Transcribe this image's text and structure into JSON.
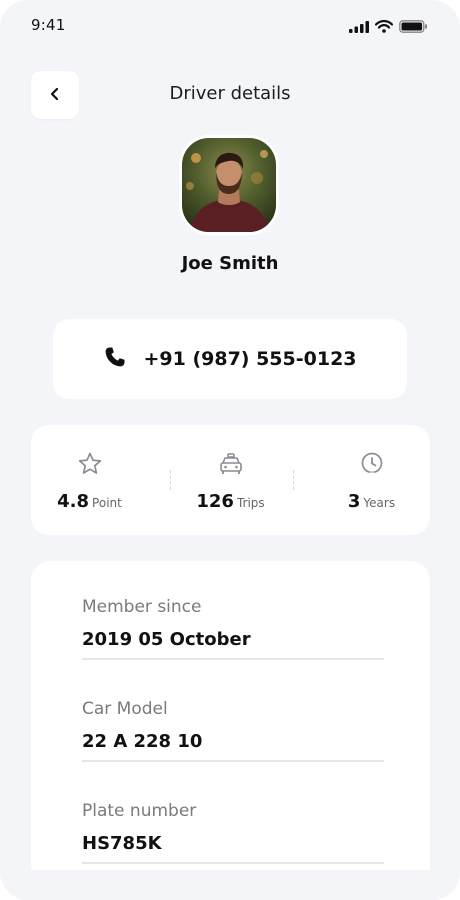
{
  "status_bar": {
    "time": "9:41"
  },
  "header": {
    "title": "Driver details"
  },
  "driver": {
    "name": "Joe Smith",
    "phone": "+91 (987) 555-0123"
  },
  "stats": [
    {
      "value": "4.8",
      "unit": "Point",
      "icon": "star-icon"
    },
    {
      "value": "126",
      "unit": "Trips",
      "icon": "car-icon"
    },
    {
      "value": "3",
      "unit": "Years",
      "icon": "clock-icon"
    }
  ],
  "details": [
    {
      "label": "Member since",
      "value": "2019 05 October"
    },
    {
      "label": "Car Model",
      "value": "22 A 228 10"
    },
    {
      "label": "Plate number",
      "value": "HS785K"
    }
  ],
  "colors": {
    "background": "#f4f5f9",
    "card": "#ffffff",
    "text": "#111111",
    "muted": "#7a7a7f"
  }
}
